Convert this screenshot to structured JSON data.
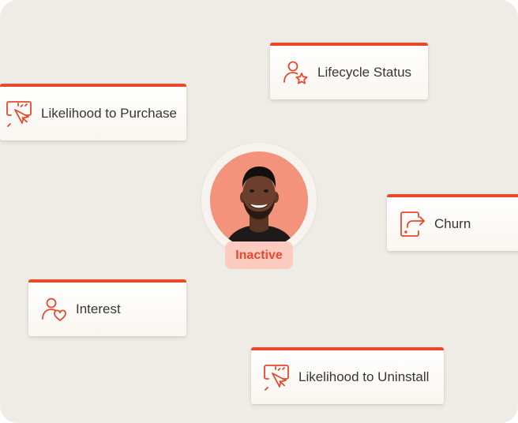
{
  "cards": {
    "lifecycle": {
      "label": "Lifecycle Status",
      "icon": "user-star-icon"
    },
    "purchase": {
      "label": "Likelihood to Purchase",
      "icon": "pointer-click-icon"
    },
    "churn": {
      "label": "Churn",
      "icon": "exit-arrow-icon"
    },
    "interest": {
      "label": "Interest",
      "icon": "user-heart-icon"
    },
    "uninstall": {
      "label": "Likelihood to Uninstall",
      "icon": "pointer-click-icon"
    }
  },
  "profile": {
    "status_label": "Inactive",
    "avatar": "person-avatar"
  },
  "colors": {
    "accent": "#e8492c",
    "background": "#efebe5",
    "avatar_bg": "#f4937c",
    "badge_bg": "#fbcbc0",
    "text": "#3a3530"
  }
}
